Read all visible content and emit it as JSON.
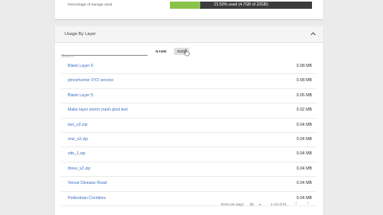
{
  "storage": {
    "percentage_label": "Percentage of storage used",
    "usage_text": "21.50% used (4.7GB of 22GB)",
    "used_fraction": 0.215,
    "fill_color": "#8bc34a"
  },
  "usage_section": {
    "title": "Usage By Layer",
    "collapse_icon": "chevron-up-icon"
  },
  "search": {
    "placeholder": "Search",
    "value": ""
  },
  "sort": {
    "name_label": "NAME",
    "size_label": "SIZE"
  },
  "layers": [
    {
      "name": "Blank Layer 6",
      "size": "0.08 MB"
    },
    {
      "name": "pincerturner XYZ service",
      "size": "0.08 MB"
    },
    {
      "name": "Blank Layer 5",
      "size": "0.06 MB"
    },
    {
      "name": "Make layer storm crash plod test",
      "size": "0.02 MB"
    },
    {
      "name": "two_v2.zip",
      "size": "0.04 MB"
    },
    {
      "name": "one_v2.zip",
      "size": "0.04 MB"
    },
    {
      "name": "site_1.zip",
      "size": "0.04 MB"
    },
    {
      "name": "three_v2.zip",
      "size": "0.04 MB"
    },
    {
      "name": "Venue Disease Road",
      "size": "0.04 MB"
    },
    {
      "name": "Pedestrian Corridors",
      "size": "0.04 MB"
    }
  ],
  "pagination": {
    "items_per_page_label": "Items per page:",
    "items_per_page": "10",
    "range": "1–10 of 45",
    "prev_icon": "chevron-left-icon",
    "next_icon": "chevron-right-icon"
  }
}
